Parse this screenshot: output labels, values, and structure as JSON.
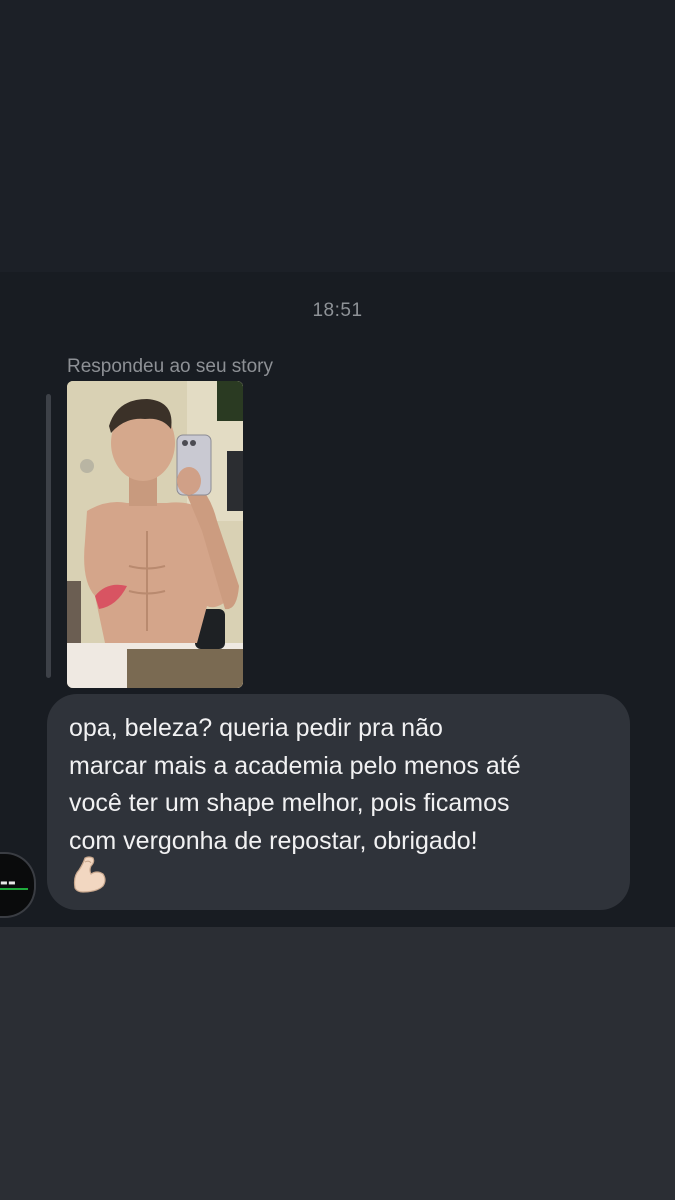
{
  "chat": {
    "timestamp": "18:51",
    "reply_context": "Respondeu ao seu story",
    "story_image": "shirtless-mirror-selfie-photo",
    "message": {
      "lines": [
        "opa, beleza? queria pedir pra não",
        "marcar mais a academia pelo menos até",
        "você ter um shape melhor, pois ficamos",
        "com vergonha de repostar, obrigado!"
      ],
      "emoji": "flexed-biceps-emoji"
    },
    "sender_avatar": "gym-logo-avatar"
  },
  "colors": {
    "background": "#181c22",
    "bubble": "#2f333a",
    "text_primary": "#f1f1f2",
    "text_secondary": "#8e9297",
    "bottom_bar": "#2b2e34"
  }
}
